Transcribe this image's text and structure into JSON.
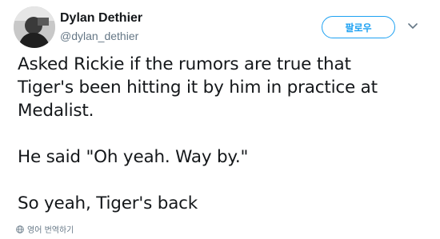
{
  "user": {
    "display_name": "Dylan Dethier",
    "handle": "@dylan_dethier"
  },
  "actions": {
    "follow_label": "팔로우",
    "more_icon": "chevron-down-icon"
  },
  "tweet": {
    "lines": [
      "Asked Rickie if the rumors are true that",
      "Tiger's been hitting it by him in practice at",
      "Medalist.",
      "",
      "He said \"Oh yeah. Way by.\"",
      "",
      "So yeah, Tiger's back"
    ]
  },
  "translate": {
    "icon": "globe-icon",
    "label": "영어 번역하기"
  },
  "colors": {
    "accent": "#1da1f2",
    "secondary_text": "#657786",
    "primary_text": "#14171a"
  }
}
